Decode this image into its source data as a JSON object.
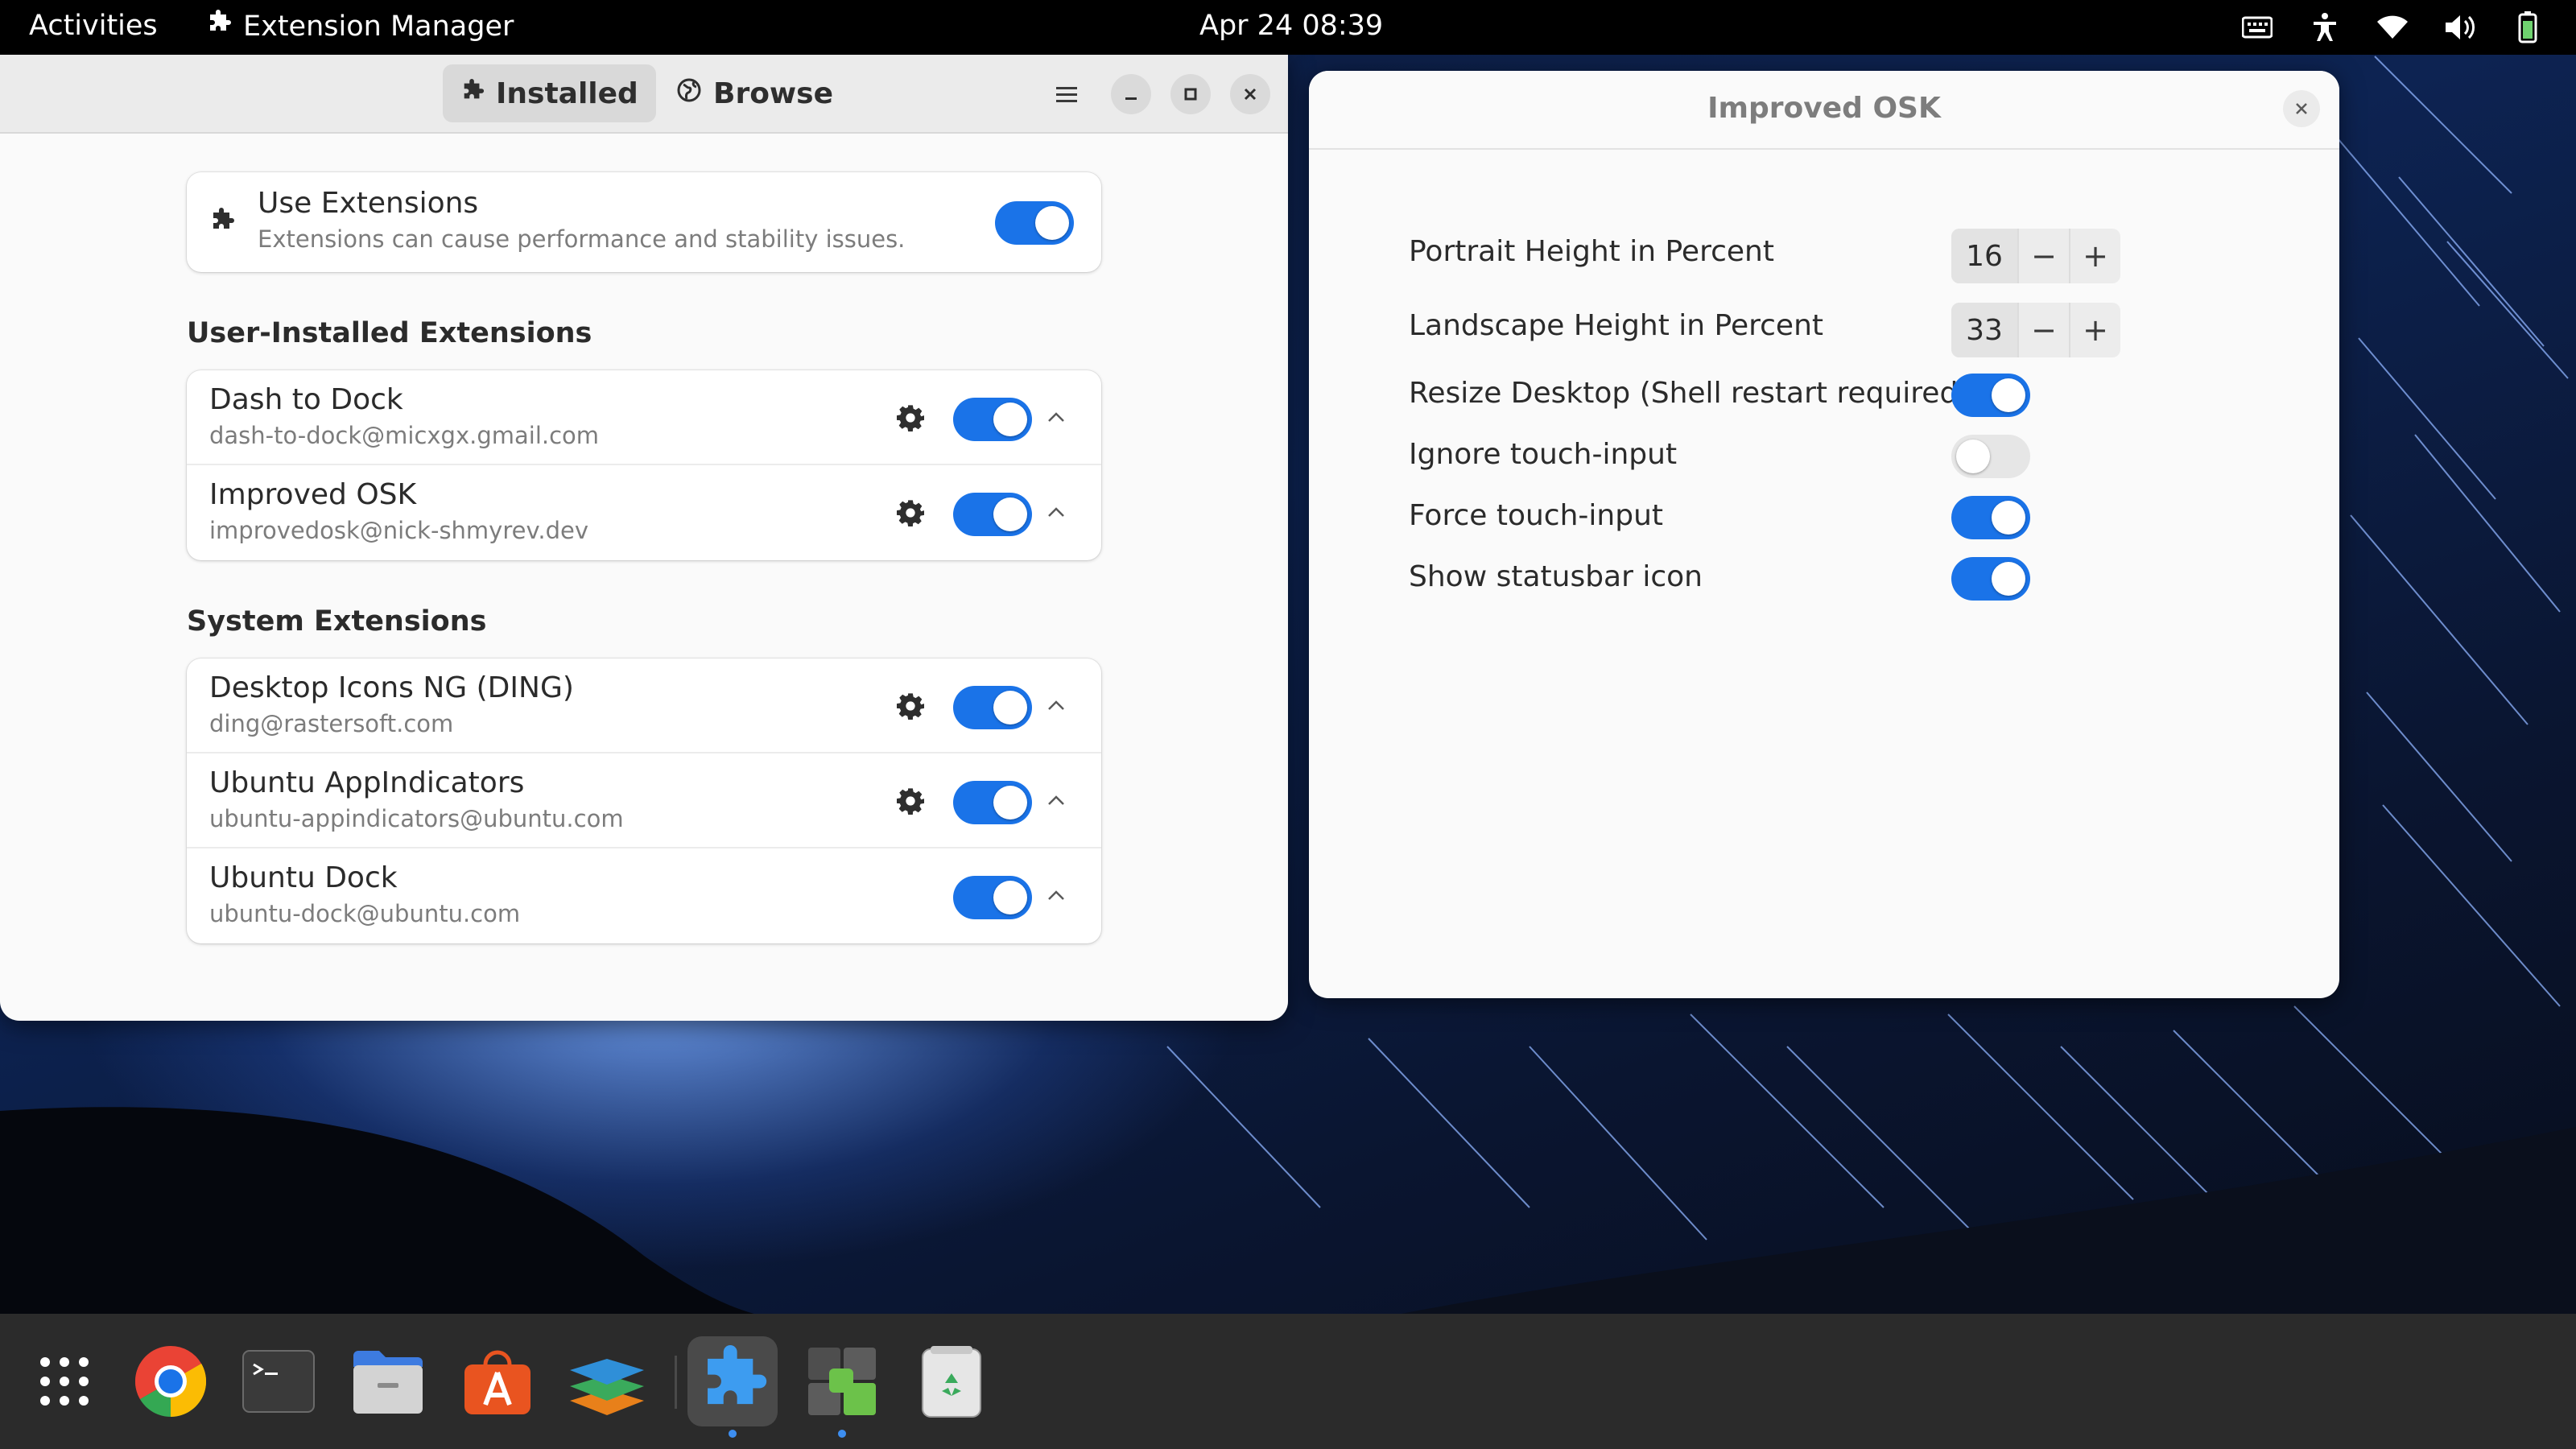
{
  "topbar": {
    "activities": "Activities",
    "app_name": "Extension Manager",
    "clock": "Apr 24  08:39",
    "tray_icons": [
      "keyboard-icon",
      "accessibility-icon",
      "wifi-icon",
      "volume-icon",
      "battery-icon"
    ]
  },
  "main_window": {
    "tabs": [
      {
        "label": "Installed",
        "icon": "puzzle-icon",
        "active": true
      },
      {
        "label": "Browse",
        "icon": "globe-icon",
        "active": false
      }
    ],
    "use_extensions": {
      "title": "Use Extensions",
      "subtitle": "Extensions can cause performance and stability issues.",
      "enabled": true
    },
    "user_section_title": "User-Installed Extensions",
    "user_extensions": [
      {
        "name": "Dash to Dock",
        "id": "dash-to-dock@micxgx.gmail.com",
        "settings": true,
        "enabled": true
      },
      {
        "name": "Improved OSK",
        "id": "improvedosk@nick-shmyrev.dev",
        "settings": true,
        "enabled": true
      }
    ],
    "system_section_title": "System Extensions",
    "system_extensions": [
      {
        "name": "Desktop Icons NG (DING)",
        "id": "ding@rastersoft.com",
        "settings": true,
        "enabled": true
      },
      {
        "name": "Ubuntu AppIndicators",
        "id": "ubuntu-appindicators@ubuntu.com",
        "settings": true,
        "enabled": true
      },
      {
        "name": "Ubuntu Dock",
        "id": "ubuntu-dock@ubuntu.com",
        "settings": false,
        "enabled": true
      }
    ]
  },
  "prefs_dialog": {
    "title": "Improved OSK",
    "portrait": {
      "label": "Portrait Height in Percent",
      "value": "16"
    },
    "landscape": {
      "label": "Landscape Height in Percent",
      "value": "33"
    },
    "spin_minus": "−",
    "spin_plus": "+",
    "toggles": [
      {
        "label": "Resize Desktop (Shell restart required)",
        "enabled": true
      },
      {
        "label": "Ignore touch-input",
        "enabled": false
      },
      {
        "label": "Force touch-input",
        "enabled": true
      },
      {
        "label": "Show statusbar icon",
        "enabled": true
      }
    ]
  },
  "dock": {
    "items": [
      "app-grid-icon",
      "chrome-icon",
      "terminal-icon",
      "files-icon",
      "app-center-icon",
      "layers-app-icon",
      "extension-manager-icon",
      "extensions-icon",
      "trash-icon"
    ],
    "active": "extension-manager-icon",
    "running": [
      "extension-manager-icon",
      "extensions-icon"
    ]
  },
  "colors": {
    "accent": "#1a73e8",
    "topbar": "#000000",
    "dock": "#2b2b2b"
  }
}
